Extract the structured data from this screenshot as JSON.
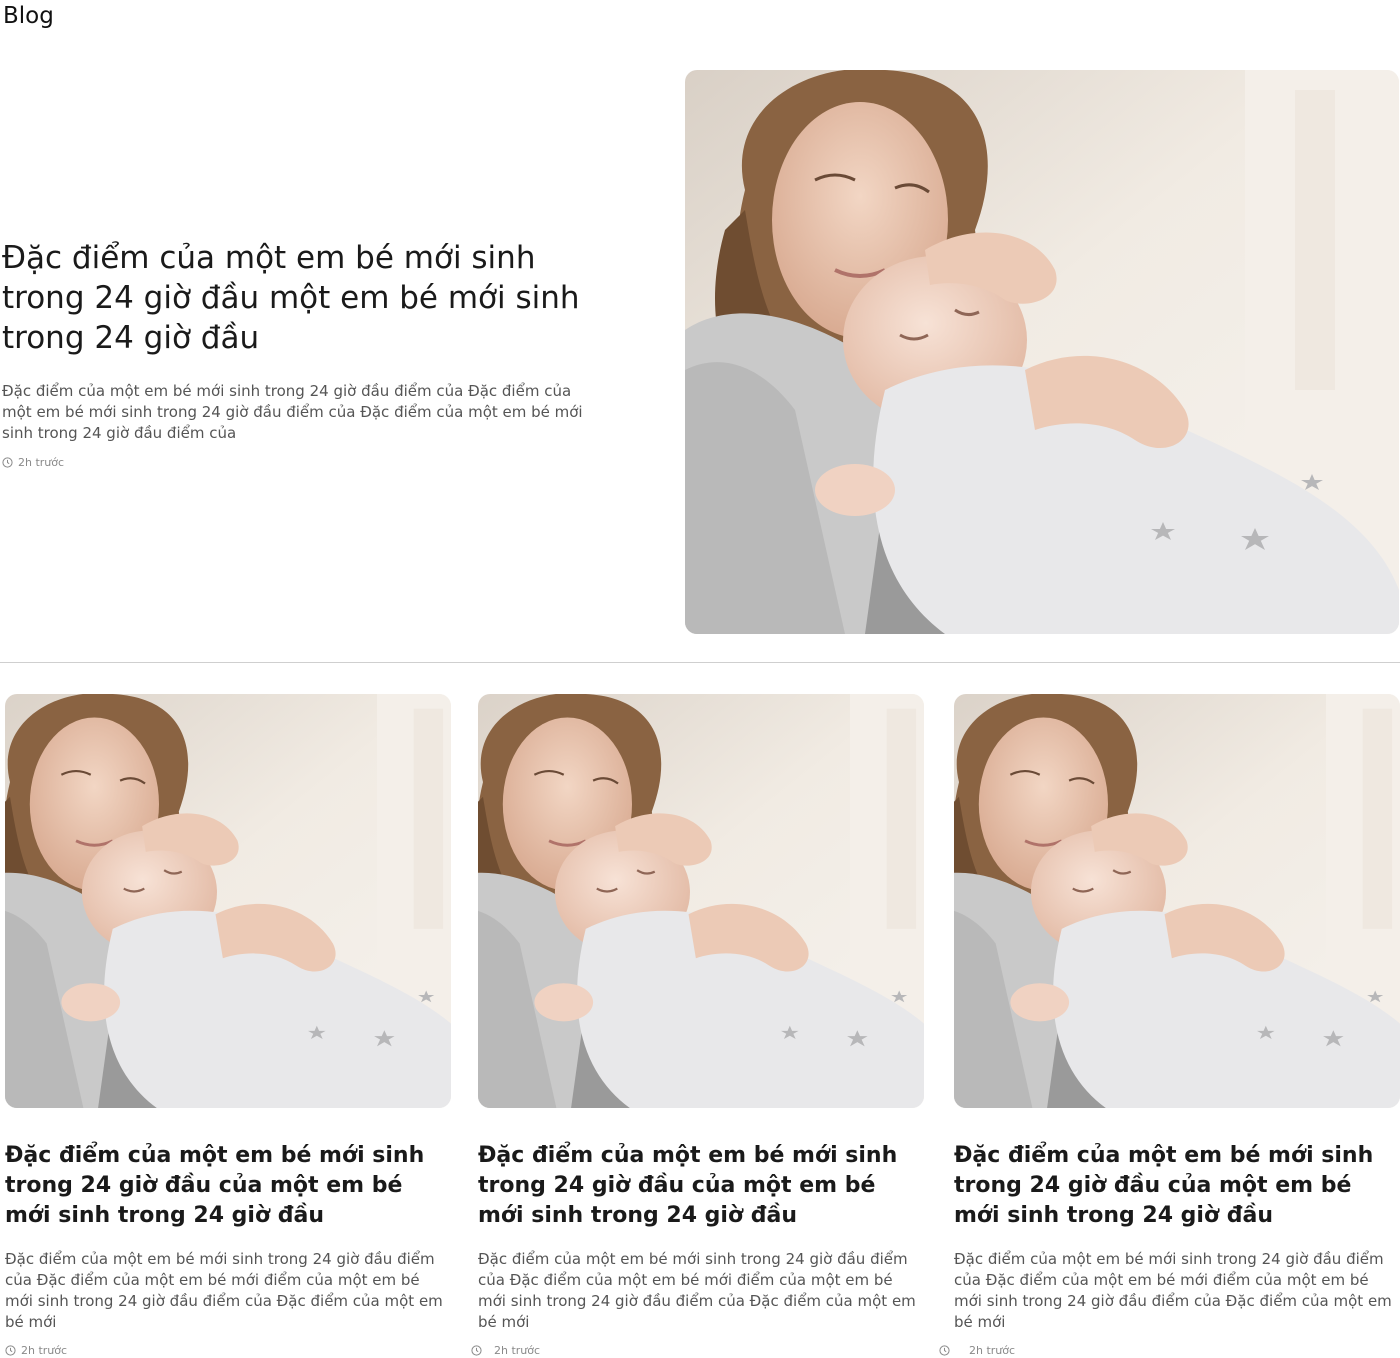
{
  "page": {
    "title": "Blog"
  },
  "featured": {
    "title": "Đặc điểm của một em bé mới sinh trong 24 giờ đầu một em bé mới sinh trong 24 giờ đầu",
    "excerpt": "Đặc điểm của một em bé mới sinh trong 24 giờ đầu điểm của Đặc điểm của một em bé mới sinh trong 24 giờ đầu điểm của Đặc điểm của một em bé mới sinh trong 24 giờ đầu điểm của",
    "time": "2h trước"
  },
  "posts": [
    {
      "title": "Đặc điểm của một em bé mới sinh trong 24 giờ đầu của một em bé mới sinh trong 24 giờ đầu",
      "excerpt": "Đặc điểm của một em bé mới sinh trong 24 giờ đầu điểm của Đặc điểm của một em bé mới điểm của một em bé mới sinh trong 24 giờ đầu điểm của Đặc điểm của một em bé mới",
      "time": "2h trước"
    },
    {
      "title": "Đặc điểm của một em bé mới sinh trong 24 giờ đầu của một em bé mới sinh trong 24 giờ đầu",
      "excerpt": "Đặc điểm của một em bé mới sinh trong 24 giờ đầu điểm của Đặc điểm của một em bé mới điểm của một em bé mới sinh trong 24 giờ đầu điểm của Đặc điểm của một em bé mới",
      "time": "2h trước"
    },
    {
      "title": "Đặc điểm của một em bé mới sinh trong 24 giờ đầu của một em bé mới sinh trong 24 giờ đầu",
      "excerpt": "Đặc điểm của một em bé mới sinh trong 24 giờ đầu điểm của Đặc điểm của một em bé mới điểm của một em bé mới sinh trong 24 giờ đầu điểm của Đặc điểm của một em bé mới",
      "time": "2h trước"
    }
  ],
  "icons": {
    "time": "clock-icon"
  }
}
